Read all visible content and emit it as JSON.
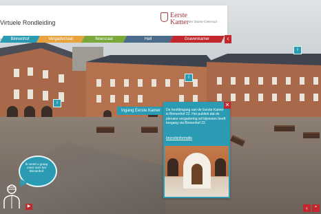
{
  "header": {
    "title": "Virtuele Rondleiding",
    "logo": {
      "line1": "Eerste",
      "line2": "Kamer",
      "subtitle": "der Staten-Generaal"
    }
  },
  "nav": {
    "tabs": [
      {
        "label": "Binnenhof",
        "color": "#2a9bb3"
      },
      {
        "label": "Vergaderzaal",
        "color": "#e8a33d"
      },
      {
        "label": "Noenzaal",
        "color": "#7aa83a"
      },
      {
        "label": "Hall",
        "color": "#4a6c8a"
      },
      {
        "label": "Gravenkamer",
        "color": "#c1272d"
      }
    ],
    "arrow_icon": "chevron-left-icon"
  },
  "hotspots": {
    "top_right": "i",
    "center": "i",
    "left": "i",
    "ingang_label": "Ingang Eerste Kamer"
  },
  "popup": {
    "text": "De hoofdingang van de Eerste Kamer is Binnenhof 22. Het publiek dat de plenaire vergadering wil bijwonen heeft toegang via Binnenhof 22.",
    "link": "bezoekinformatie",
    "close_icon": "close-icon"
  },
  "bubble": {
    "text": "Ik vertel u graag meer over het Binnenhof"
  },
  "controls": {
    "bubble_next_icon": "play-icon",
    "prev_icon": "chevron-left-icon",
    "up_icon": "chevron-up-icon"
  },
  "colors": {
    "accent": "#2a9bb3",
    "brand_red": "#c1272d"
  }
}
